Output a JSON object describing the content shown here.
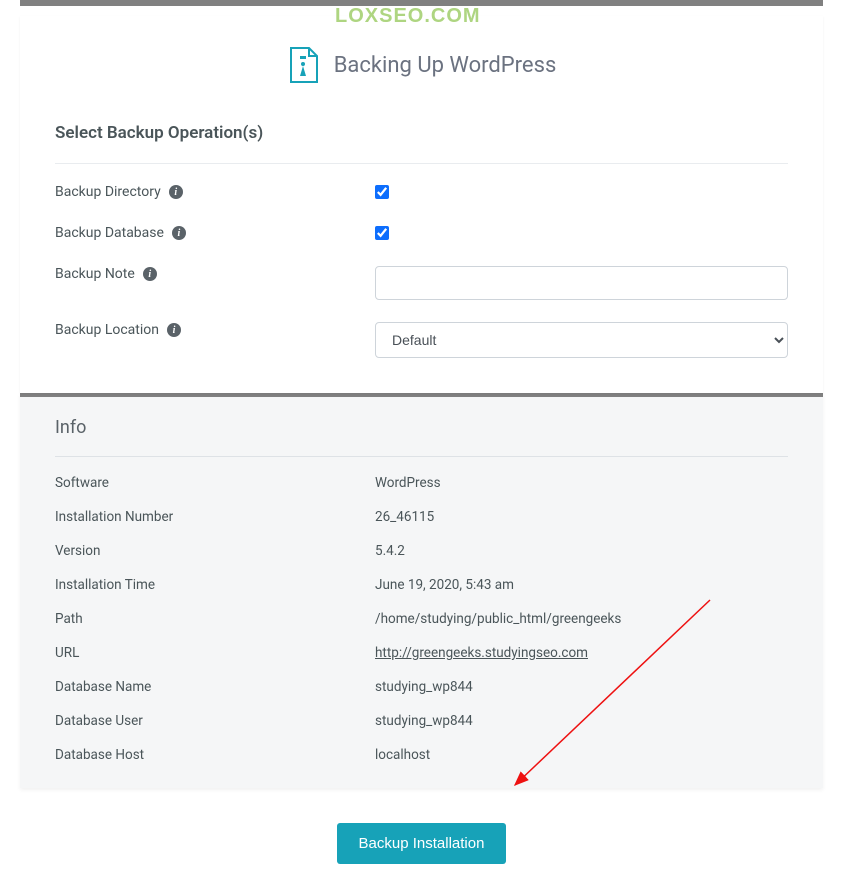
{
  "watermark": "LOXSEO.COM",
  "header": {
    "title": "Backing Up WordPress"
  },
  "section": {
    "heading": "Select Backup Operation(s)",
    "rows": {
      "backup_directory": {
        "label": "Backup Directory",
        "checked": true
      },
      "backup_database": {
        "label": "Backup Database",
        "checked": true
      },
      "backup_note": {
        "label": "Backup Note",
        "value": ""
      },
      "backup_location": {
        "label": "Backup Location",
        "selected": "Default"
      }
    }
  },
  "info": {
    "heading": "Info",
    "rows": {
      "software": {
        "label": "Software",
        "value": "WordPress"
      },
      "install_number": {
        "label": "Installation Number",
        "value": "26_46115"
      },
      "version": {
        "label": "Version",
        "value": "5.4.2"
      },
      "install_time": {
        "label": "Installation Time",
        "value": "June 19, 2020, 5:43 am"
      },
      "path": {
        "label": "Path",
        "value": "/home/studying/public_html/greengeeks"
      },
      "url": {
        "label": "URL",
        "value": "http://greengeeks.studyingseo.com"
      },
      "db_name": {
        "label": "Database Name",
        "value": "studying_wp844"
      },
      "db_user": {
        "label": "Database User",
        "value": "studying_wp844"
      },
      "db_host": {
        "label": "Database Host",
        "value": "localhost"
      }
    }
  },
  "button": {
    "label": "Backup Installation"
  }
}
